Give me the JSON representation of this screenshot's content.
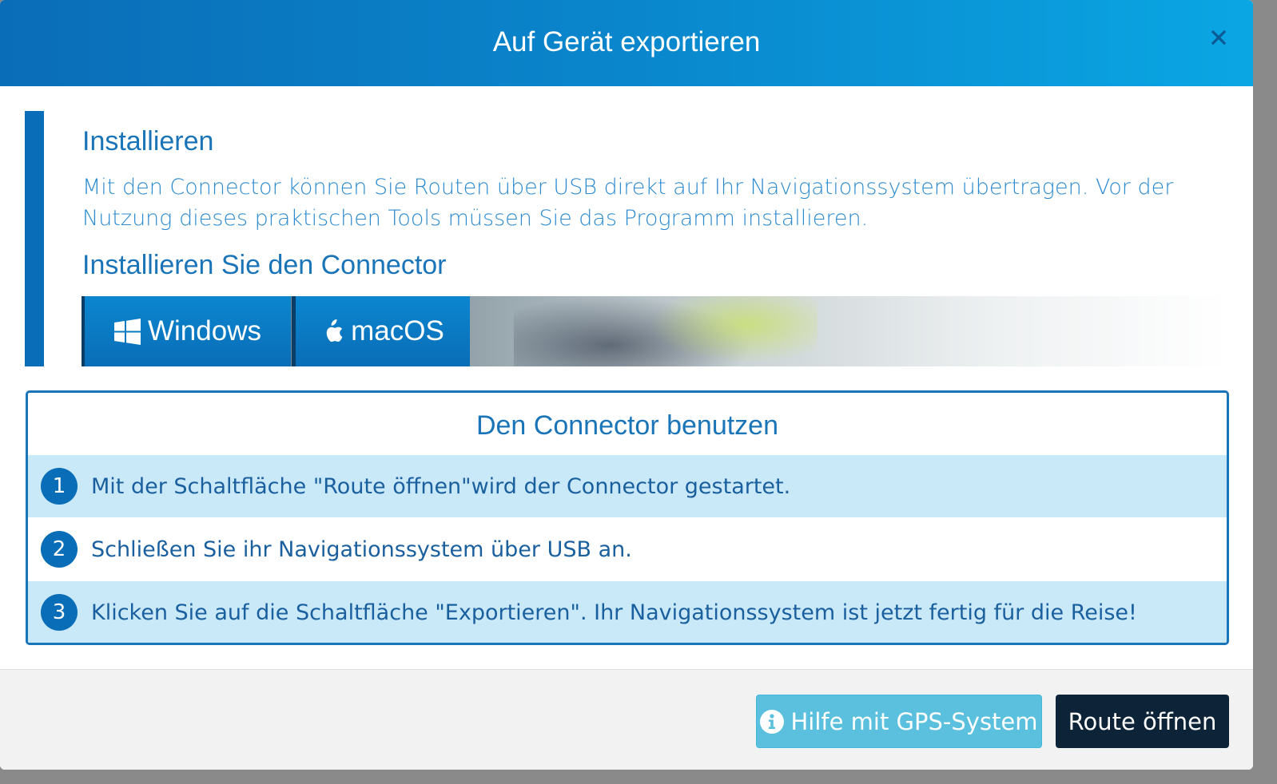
{
  "dialog": {
    "title": "Auf Gerät exportieren",
    "close_icon": "close-icon"
  },
  "install": {
    "title": "Installieren",
    "text": "Mit den Connector können Sie Routen über USB direkt auf Ihr Navigationssystem übertragen. Vor der Nutzung dieses praktischen Tools müssen Sie das Programm installieren.",
    "subtitle": "Installieren Sie den Connector",
    "windows_label": "Windows",
    "windows_icon": "windows-icon",
    "mac_label": "macOS",
    "mac_icon": "apple-icon"
  },
  "use": {
    "title": "Den Connector benutzen",
    "steps": [
      {
        "number": "1",
        "text": "Mit der Schaltfläche \"Route öffnen\"wird der Connector gestartet."
      },
      {
        "number": "2",
        "text": "Schließen Sie ihr Navigationssystem über USB an."
      },
      {
        "number": "3",
        "text": "Klicken Sie auf die Schaltfläche \"Exportieren\". Ihr Navigationssystem ist jetzt fertig für die Reise!"
      }
    ]
  },
  "footer": {
    "help_label": "Hilfe mit GPS-System",
    "help_icon": "info-icon",
    "open_label": "Route öffnen"
  },
  "colors": {
    "primary": "#0a6db7",
    "header_end": "#0aa6e3",
    "step_highlight": "#c9e8f8",
    "help_button": "#5bc0de",
    "open_button": "#0d2438"
  }
}
